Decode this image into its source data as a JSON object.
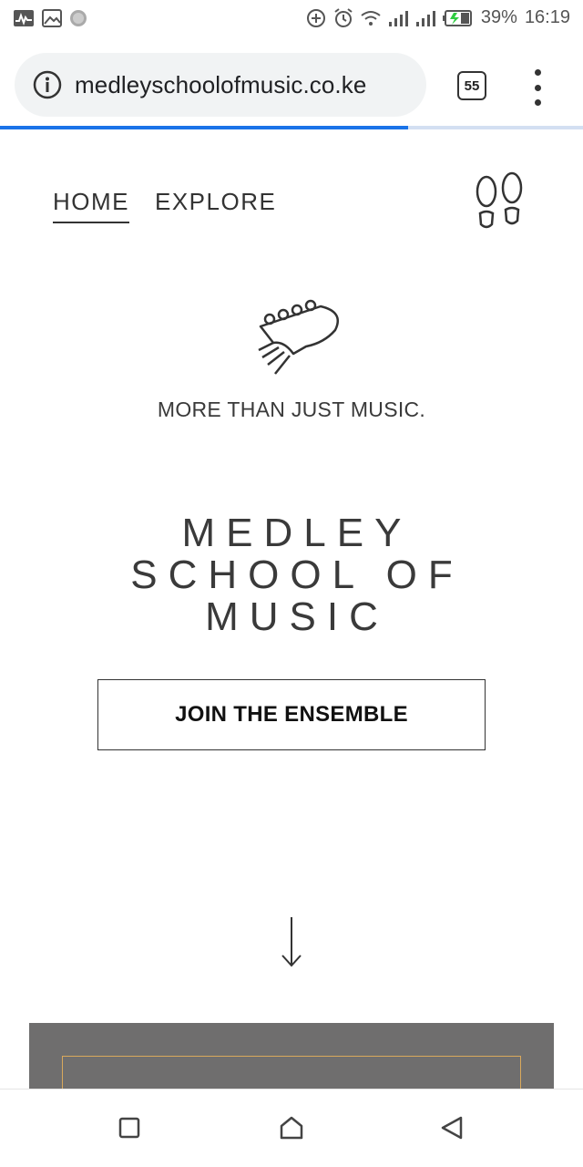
{
  "status_bar": {
    "battery": "39%",
    "time": "16:19"
  },
  "browser": {
    "url": "medleyschoolofmusic.co.ke",
    "tab_count": "55",
    "load_progress_percent": 70
  },
  "nav": {
    "items": [
      {
        "label": "HOME",
        "active": true
      },
      {
        "label": "EXPLORE",
        "active": false
      }
    ]
  },
  "hero": {
    "tagline": "MORE THAN JUST MUSIC.",
    "title_lines": [
      "MEDLEY",
      "SCHOOL OF",
      "MUSIC"
    ],
    "cta_label": "JOIN THE ENSEMBLE"
  },
  "colors": {
    "accent_frame": "#d9a85c",
    "section_bg": "#6f6e6e",
    "progress": "#1a73e8"
  }
}
